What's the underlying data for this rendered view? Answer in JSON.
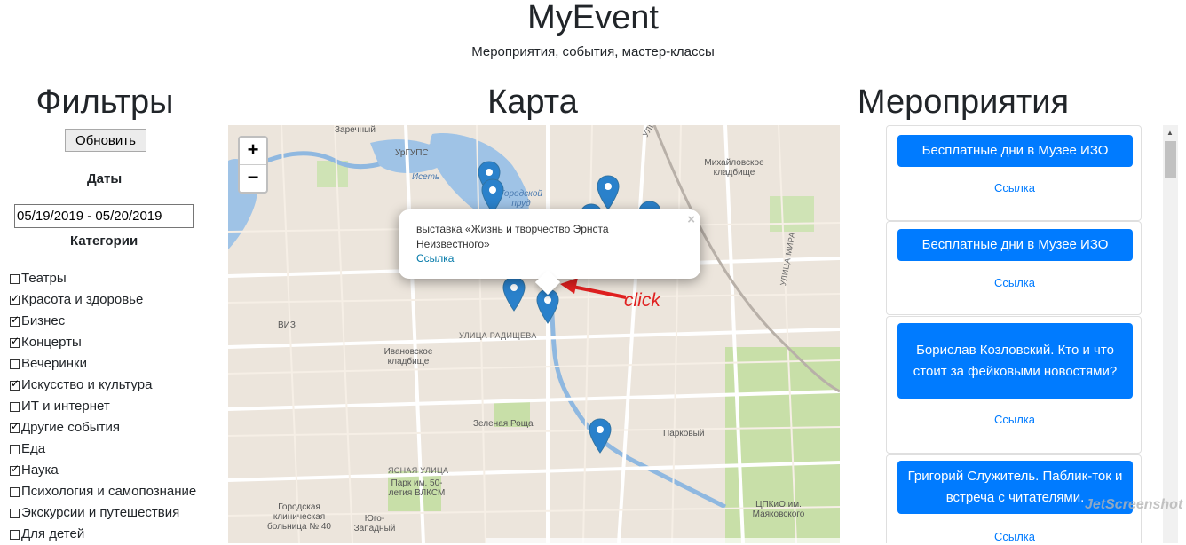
{
  "header": {
    "title": "MyEvent",
    "subtitle": "Мероприятия, события, мастер-классы"
  },
  "sections": {
    "filters": "Фильтры",
    "map": "Карта",
    "events": "Мероприятия"
  },
  "filters": {
    "refresh_label": "Обновить",
    "dates_label": "Даты",
    "date_range_value": "05/19/2019 - 05/20/2019",
    "categories_label": "Категории",
    "categories": [
      {
        "label": "Театры",
        "checked": false
      },
      {
        "label": "Красота и здоровье",
        "checked": true
      },
      {
        "label": "Бизнес",
        "checked": true
      },
      {
        "label": "Концерты",
        "checked": true
      },
      {
        "label": "Вечеринки",
        "checked": false
      },
      {
        "label": "Искусство и культура",
        "checked": true
      },
      {
        "label": "ИТ и интернет",
        "checked": false
      },
      {
        "label": "Другие события",
        "checked": true
      },
      {
        "label": "Еда",
        "checked": false
      },
      {
        "label": "Наука",
        "checked": true
      },
      {
        "label": "Психология и самопознание",
        "checked": false
      },
      {
        "label": "Экскурсии и путешествия",
        "checked": false
      },
      {
        "label": "Для детей",
        "checked": false
      }
    ]
  },
  "map": {
    "zoom_in": "+",
    "zoom_out": "−",
    "popup": {
      "text": "выставка «Жизнь и творчество Эрнста Неизвестного»",
      "link": "Ссылка",
      "close": "×"
    },
    "annotation": "click",
    "places": {
      "zarechny": "Заречный",
      "urgups": "УрГУПС",
      "iset": "Исеть",
      "gorodskoy_prud": "Городской пруд",
      "mikhailovskoe": "Михайловское кладбище",
      "viz": "ВИЗ",
      "ivanovskoe": "Ивановское кладбище",
      "radishcheva": "УЛИЦА РАДИЩЕВА",
      "zelenaya_roshcha": "Зеленая Роща",
      "parkovy": "Парковый",
      "park_vlksm": "Парк им. 50-летия ВЛКСМ",
      "yasnaya": "ЯСНАЯ УЛИЦА",
      "hospital": "Городская клиническая больница № 40",
      "yugo_zapadny": "Юго-Западный",
      "tspkio": "ЦПКиО им. Маяковского",
      "ulitsa_mira": "УЛИЦА МИРА",
      "ulitsa_tsvillinga": "УЛИЦА ЦВИЛЛИНГА"
    }
  },
  "events": [
    {
      "title": "Бесплатные дни в Музее ИЗО",
      "link": "Ссылка"
    },
    {
      "title": "Бесплатные дни в Музее ИЗО",
      "link": "Ссылка"
    },
    {
      "title": "Борислав Козловский. Кто и что стоит за фейковыми новостями?",
      "link": "Ссылка"
    },
    {
      "title": "Григорий Служитель. Паблик-ток и встреча с читателями.",
      "link": "Ссылка"
    }
  ],
  "watermark": "JetScreenshot",
  "colors": {
    "primary": "#007bff",
    "annotation": "#e02020",
    "water": "#8fb8e0",
    "park": "#c8dfa8"
  }
}
